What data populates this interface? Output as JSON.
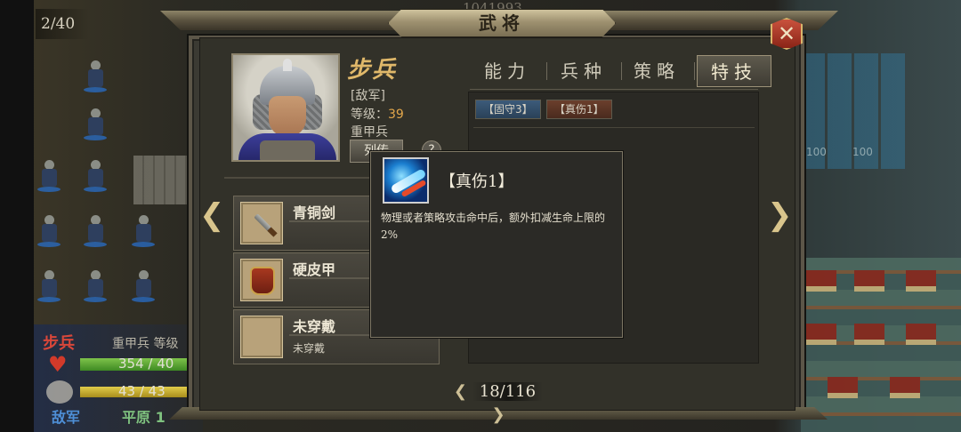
{
  "background": {
    "page_counter": "2/40",
    "top_number": "1041993",
    "right_numbers": [
      "100",
      "100"
    ],
    "unit": {
      "name": "步兵",
      "info": "重甲兵 等级",
      "hp_text": "354 / 40",
      "hp_fraction": 1.0,
      "mp_text": "43 / 43",
      "mp_fraction": 1.0,
      "faction": "敌军",
      "terrain": "平原 1"
    }
  },
  "dialog": {
    "title": "武将",
    "close_icon": "close-x-icon",
    "general": {
      "name": "步兵",
      "faction": "[敌军]",
      "level_label": "等级：",
      "level_value": "39",
      "unit_type": "重甲兵",
      "leave_button": "列传",
      "help_label": "?"
    },
    "tabs": [
      {
        "label": "能力",
        "active": false
      },
      {
        "label": "兵种",
        "active": false
      },
      {
        "label": "策略",
        "active": false
      },
      {
        "label": "特技",
        "active": true
      }
    ],
    "skills": [
      {
        "label": "【固守3】",
        "color": "#3c5b7a"
      },
      {
        "label": "【真伤1】",
        "color": "#6b3f2c"
      }
    ],
    "equipment": [
      {
        "name": "青铜剑",
        "sub": "",
        "icon": "sword-icon"
      },
      {
        "name": "硬皮甲",
        "sub": "",
        "icon": "armor-icon"
      },
      {
        "name": "未穿戴",
        "sub": "未穿戴",
        "icon": "empty-slot-icon"
      }
    ],
    "pager": {
      "prev": "❮",
      "text": "18/116",
      "next": "❯"
    },
    "nav_prev": "❮",
    "nav_next": "❯",
    "tooltip": {
      "title": "【真伤1】",
      "description": "物理或者策略攻击命中后，额外扣减生命上限的2%",
      "icon": "skill-slash-icon"
    }
  }
}
